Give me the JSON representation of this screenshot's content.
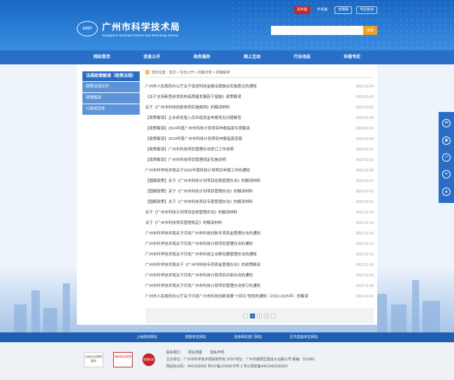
{
  "header": {
    "site_name": "广州市科学技术局",
    "site_name_en": "Guangzhou Municipal Science and Technology Bureau",
    "logo_badge": "GZST",
    "top_links": [
      "关怀版",
      "手机版",
      "无障碍",
      "市民热线"
    ],
    "search_placeholder": "",
    "search_button": "搜索"
  },
  "nav": [
    "网站首页",
    "信息公开",
    "政务服务",
    "网上互动",
    "行业动态",
    "科普专栏"
  ],
  "sidebar": {
    "heading": "法规政策解读（政策法规）",
    "items": [
      "政策法规文件",
      "政策解读",
      "行政规范性"
    ]
  },
  "breadcrumb": "您的位置：首页 > 信息公开 > 政策法规 > 政策解读",
  "articles": [
    {
      "title": "广州市人民政府办公厅关于促进科技金融深度融合实施意见的通知",
      "date": "2023-03-24"
    },
    {
      "title": "《关于支持新型研发机构高质量发展若干措施》政策解读",
      "date": "2023-03-10"
    },
    {
      "title": "关于《广州市科技创新条例实施细则》的解读材料",
      "date": "2023-03-01"
    },
    {
      "title": "【政策解读】企业研发投入后补助资金申报常见问题解答",
      "date": "2023-02-25"
    },
    {
      "title": "【政策解读】2024年度广州市科技计划项目申报指南专项解读",
      "date": "2023-02-24"
    },
    {
      "title": "【政策解读】2024年度广州市科技计划项目申报指南答疑",
      "date": "2023-02-24"
    },
    {
      "title": "【政策解读】广州市科技项目管理办法修订工作说明",
      "date": "2023-02-21"
    },
    {
      "title": "【政策解读】广州市科技项目管理规定实施说明",
      "date": "2023-02-21"
    },
    {
      "title": "广州市科学技术局关于2023年度科技计划项目申报工作的通知",
      "date": "2023-02-20"
    },
    {
      "title": "【图解政策】关于《广州市科技计划项目经费管理办法》的解读材料",
      "date": "2023-02-21"
    },
    {
      "title": "【图解政策】关于《广州市科技计划项目管理办法》的解读材料",
      "date": "2023-02-21"
    },
    {
      "title": "【图解政策】关于《广州市科技项目专家管理办法》的解读材料",
      "date": "2023-02-21"
    },
    {
      "title": "关于《广州市科技计划项目验收管理办法》的解读材料",
      "date": "2022-12-16"
    },
    {
      "title": "关于《广州市科技项目管理规定》的解读材料",
      "date": "2022-12-16"
    },
    {
      "title": "广州市科学技术局关于印发广州市科技创新专项资金管理办法的通知",
      "date": "2022-12-16"
    },
    {
      "title": "广州市科学技术局关于印发广州市科技计划项目管理办法的通知",
      "date": "2022-12-16"
    },
    {
      "title": "广州市科学技术局关于印发广州市科技企业孵化器管理办法的通知",
      "date": "2022-12-16"
    },
    {
      "title": "广州市科学技术局关于《广州市科技专项资金管理办法》的政策解读",
      "date": "2022-12-16"
    },
    {
      "title": "广州市科学技术局关于印发广州市科技计划项目评审办法的通知",
      "date": "2022-12-16"
    },
    {
      "title": "广州市科学技术局关于印发广州市科技计划项目管理办法修订的通知",
      "date": "2022-11-30"
    },
    {
      "title": "广州市人民政府办公厅关于印发广州市科技创新发展“十四五”规划的通知（2022-2025年）的解读",
      "date": "2022-10-16"
    }
  ],
  "pager": [
    "<",
    "1",
    "2",
    "3",
    ">"
  ],
  "float_icons": [
    "wechat-icon",
    "weibo-icon",
    "share-icon",
    "link-icon",
    "top-icon"
  ],
  "links_bar": [
    "上级政府网站",
    "部委单位网站",
    "省级相关部门网站",
    "区市直属单位网站"
  ],
  "footer": {
    "badges": [
      "适老化无障碍服务",
      "政府网站找错",
      "党政机关"
    ],
    "links": [
      "联系我们",
      "网站地图",
      "隐私声明"
    ],
    "line1": "主办单位：广州市科学技术局版权所有 2018 地址：广州市越秀区建设大马路11号 邮编：510060",
    "line2": "网站标识码：4401000005 粤ICP备12345678号-1 粤公网安备44010402003557"
  },
  "colors": {
    "primary": "#2b6cc4",
    "accent": "#f0a01e",
    "red": "#c8262a"
  }
}
